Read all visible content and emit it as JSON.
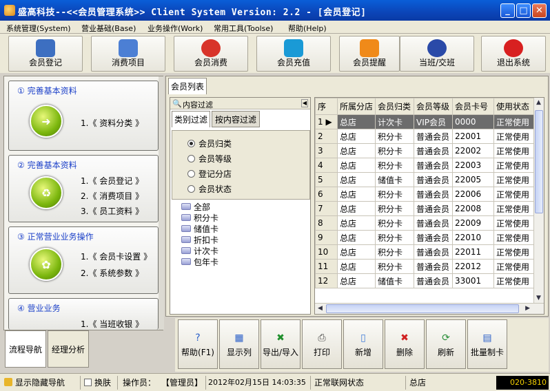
{
  "window": {
    "title": "盛高科技--<<会员管理系统>>   Client System     Version: 2.2 - [会员登记]",
    "controls": {
      "minimize": "_",
      "maximize": "□",
      "close": "✕"
    }
  },
  "menu": [
    {
      "label": "系统管理(System)"
    },
    {
      "label": "营业基础(Base)"
    },
    {
      "label": "业务操作(Work)"
    },
    {
      "label": "常用工具(Toolse)"
    },
    {
      "label": "帮助(Help)"
    }
  ],
  "toolbar": [
    {
      "label": "会员登记",
      "icon": "users-icon",
      "color": "#3d6fc1"
    },
    {
      "label": "消费项目",
      "icon": "monitor-gear-icon",
      "color": "#4c7fd4"
    },
    {
      "label": "会员消费",
      "icon": "check-ball-icon",
      "color": "#d8342a"
    },
    {
      "label": "会员充值",
      "icon": "yen-icon",
      "color": "#1a9ad6"
    },
    {
      "label": "会员提醒",
      "icon": "rss-icon",
      "color": "#f08a19"
    },
    {
      "label": "当班/交班",
      "icon": "globe-icon",
      "color": "#2a4aa8"
    },
    {
      "label": "退出系统",
      "icon": "power-icon",
      "color": "#d82020"
    }
  ],
  "nav": {
    "cards": [
      {
        "heading": "① 完善基本资料",
        "links": [
          "1.《 资料分类 》"
        ]
      },
      {
        "heading": "② 完善基本资料",
        "links": [
          "1.《 会员登记 》",
          "2.《 消费项目 》",
          "3.《 员工资料 》"
        ]
      },
      {
        "heading": "③ 正常营业业务操作",
        "links": [
          "1.《 会员卡设置 》",
          "2.《 系统参数 》"
        ]
      },
      {
        "heading": "④ 营业业务",
        "links": [
          "1.《 当班收银 》"
        ]
      }
    ],
    "tabs": [
      {
        "label": "流程导航"
      },
      {
        "label": "经理分析"
      }
    ]
  },
  "list_tab": "会员列表",
  "filter": {
    "header": "内容过滤",
    "tabs": [
      "类别过滤",
      "按内容过滤"
    ],
    "radios": [
      {
        "label": "会员归类",
        "checked": true
      },
      {
        "label": "会员等级",
        "checked": false
      },
      {
        "label": "登记分店",
        "checked": false
      },
      {
        "label": "会员状态",
        "checked": false
      }
    ],
    "tree": [
      "全部",
      "积分卡",
      "储值卡",
      "折扣卡",
      "计次卡",
      "包年卡"
    ]
  },
  "table": {
    "columns": [
      "序",
      "所属分店",
      "会员归类",
      "会员等级",
      "会员卡号",
      "使用状态"
    ],
    "rows": [
      [
        "1",
        "总店",
        "计次卡",
        "VIP会员",
        "0000",
        "正常使用"
      ],
      [
        "2",
        "总店",
        "积分卡",
        "普通会员",
        "22001",
        "正常使用"
      ],
      [
        "3",
        "总店",
        "积分卡",
        "普通会员",
        "22002",
        "正常使用"
      ],
      [
        "4",
        "总店",
        "积分卡",
        "普通会员",
        "22003",
        "正常使用"
      ],
      [
        "5",
        "总店",
        "储值卡",
        "普通会员",
        "22005",
        "正常使用"
      ],
      [
        "6",
        "总店",
        "积分卡",
        "普通会员",
        "22006",
        "正常使用"
      ],
      [
        "7",
        "总店",
        "积分卡",
        "普通会员",
        "22008",
        "正常使用"
      ],
      [
        "8",
        "总店",
        "积分卡",
        "普通会员",
        "22009",
        "正常使用"
      ],
      [
        "9",
        "总店",
        "积分卡",
        "普通会员",
        "22010",
        "正常使用"
      ],
      [
        "10",
        "总店",
        "积分卡",
        "普通会员",
        "22011",
        "正常使用"
      ],
      [
        "11",
        "总店",
        "积分卡",
        "普通会员",
        "22012",
        "正常使用"
      ],
      [
        "12",
        "总店",
        "储值卡",
        "普通会员",
        "33001",
        "正常使用"
      ]
    ],
    "selected_row": 0
  },
  "actions": [
    {
      "label": "帮助(F1)",
      "icon": "help-icon",
      "glyph": "?",
      "color": "#2a5fc8"
    },
    {
      "label": "显示列",
      "icon": "grid-icon",
      "glyph": "▦",
      "color": "#2a5fc8"
    },
    {
      "label": "导出/导入",
      "icon": "excel-icon",
      "glyph": "✖",
      "color": "#1f8f2c"
    },
    {
      "label": "打印",
      "icon": "printer-icon",
      "glyph": "⎙",
      "color": "#444444"
    },
    {
      "label": "新增",
      "icon": "new-doc-icon",
      "glyph": "▯",
      "color": "#3d7bd8"
    },
    {
      "label": "删除",
      "icon": "delete-icon",
      "glyph": "✖",
      "color": "#d02020"
    },
    {
      "label": "刷新",
      "icon": "refresh-icon",
      "glyph": "⟳",
      "color": "#2a8f3a"
    },
    {
      "label": "批量制卡",
      "icon": "cards-icon",
      "glyph": "▤",
      "color": "#2a5fc8"
    }
  ],
  "status": {
    "toggle_nav": "显示隐藏导航",
    "skin": "换肤",
    "operator_label": "操作员：",
    "operator": "【管理员】",
    "datetime": "2012年02月15日 14:03:35",
    "network": "正常联网状态",
    "branch": "总店",
    "phone": "020-3810"
  }
}
